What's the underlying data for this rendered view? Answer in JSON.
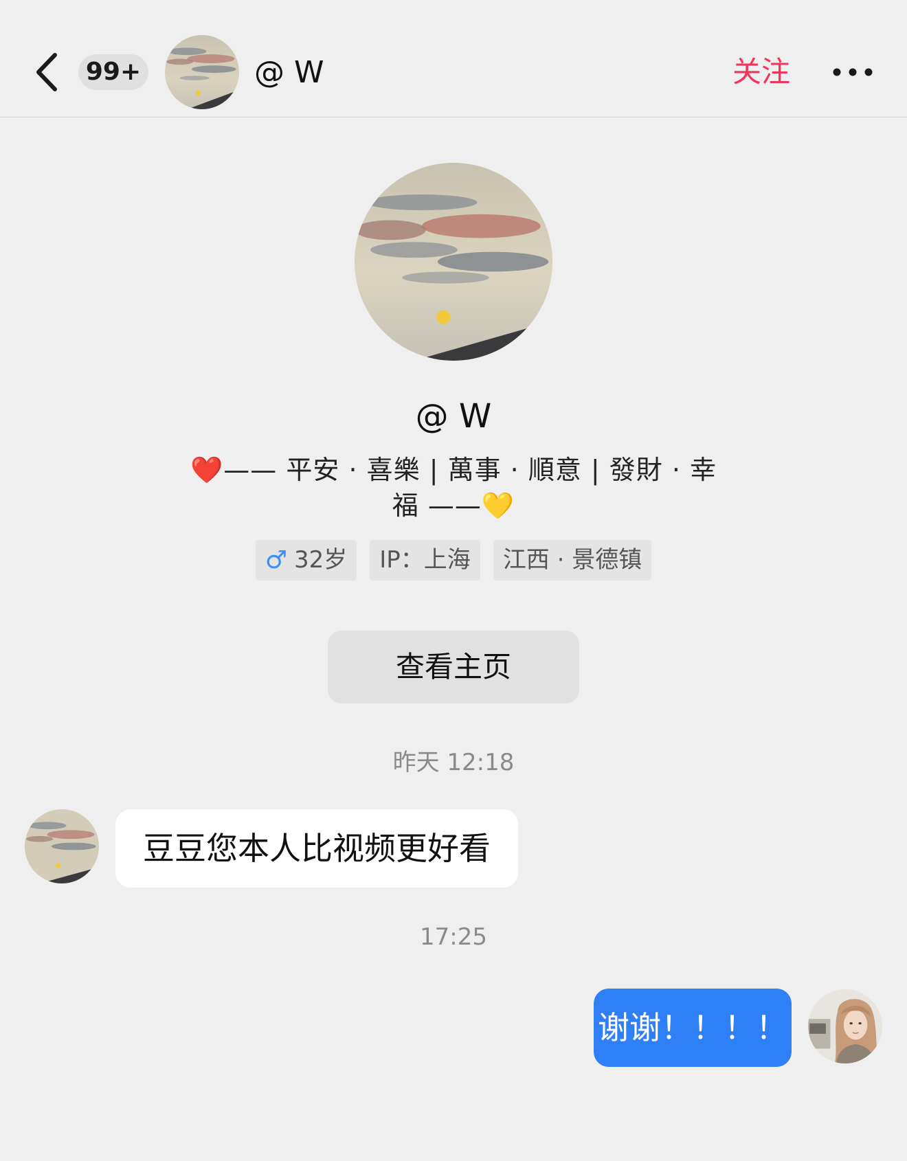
{
  "header": {
    "back_icon": "chevron-left-icon",
    "unread_badge": "99+",
    "contact_name": "@ W",
    "follow_label": "关注",
    "follow_color": "#f0345d",
    "more_icon": "more-horizontal-icon"
  },
  "profile": {
    "name": "@ W",
    "bio_line1": "❤️—— 平安 · 喜樂 | 萬事 · 順意 | 發財 · 幸",
    "bio_line2": "福 ——💛",
    "tags": {
      "gender_icon": "male-icon",
      "age": "32岁",
      "ip": "IP：上海",
      "location": "江西 · 景德镇"
    },
    "homepage_button": "查看主页"
  },
  "chat": {
    "messages": [
      {
        "timestamp": "昨天 12:18",
        "side": "left",
        "text": "豆豆您本人比视频更好看"
      },
      {
        "timestamp": "17:25",
        "side": "right",
        "text": "谢谢！！！！"
      }
    ],
    "bubble_color_self": "#2f80f7",
    "bubble_color_other": "#ffffff"
  }
}
